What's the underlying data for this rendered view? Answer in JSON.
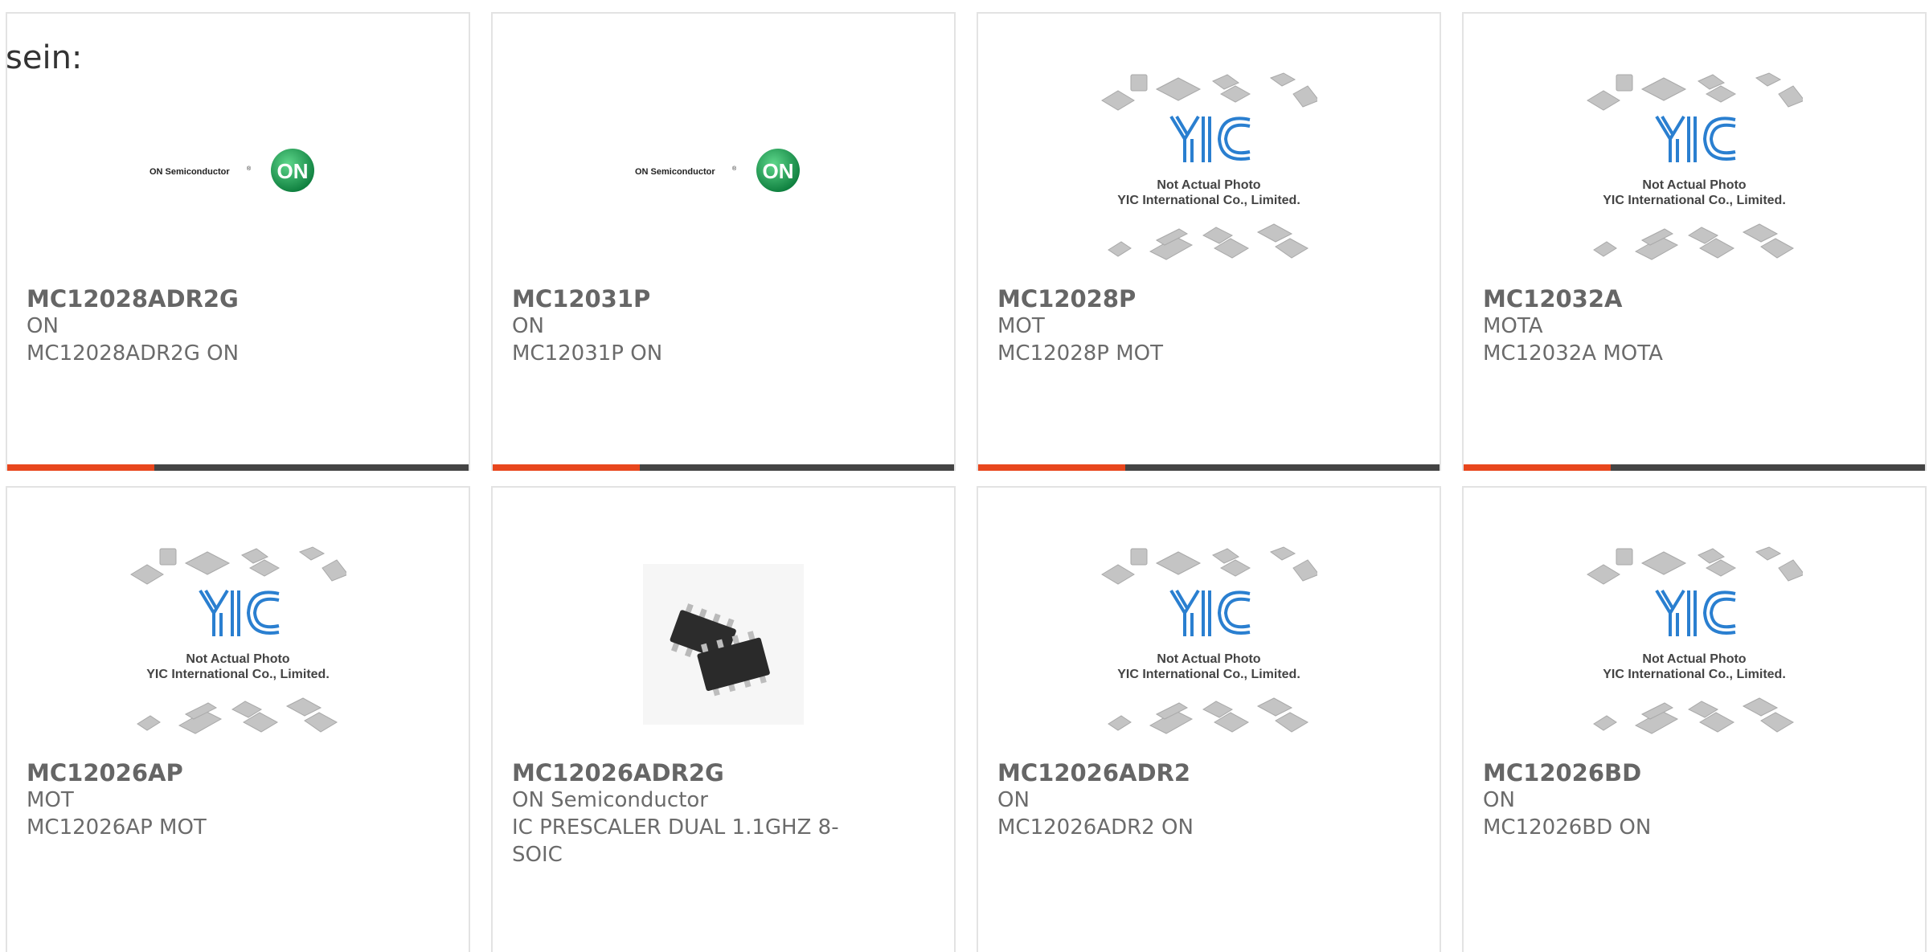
{
  "intro_text": "sein:",
  "accent_color": "#e8461d",
  "bar_color": "#444444",
  "logo_text": {
    "on_brand": "ON Semiconductor",
    "on_mark": "ON",
    "yic_mark": "YIC",
    "yic_line1": "Not Actual Photo",
    "yic_line2": "YIC International Co., Limited."
  },
  "cards": [
    {
      "part_number": "MC12028ADR2G",
      "manufacturer": "ON",
      "description": "MC12028ADR2G ON",
      "image": "on-semiconductor-logo",
      "has_bar": true
    },
    {
      "part_number": "MC12031P",
      "manufacturer": "ON",
      "description": "MC12031P ON",
      "image": "on-semiconductor-logo",
      "has_bar": true
    },
    {
      "part_number": "MC12028P",
      "manufacturer": "MOT",
      "description": "MC12028P MOT",
      "image": "yic-not-actual-photo",
      "has_bar": true
    },
    {
      "part_number": "MC12032A",
      "manufacturer": "MOTA",
      "description": "MC12032A MOTA",
      "image": "yic-not-actual-photo",
      "has_bar": true
    },
    {
      "part_number": "MC12026AP",
      "manufacturer": "MOT",
      "description": "MC12026AP MOT",
      "image": "yic-not-actual-photo",
      "has_bar": false
    },
    {
      "part_number": "MC12026ADR2G",
      "manufacturer": "ON Semiconductor",
      "description": "IC PRESCALER DUAL 1.1GHZ 8-SOIC",
      "image": "soic-8-chip-photo",
      "has_bar": false
    },
    {
      "part_number": "MC12026ADR2",
      "manufacturer": "ON",
      "description": "MC12026ADR2 ON",
      "image": "yic-not-actual-photo",
      "has_bar": false
    },
    {
      "part_number": "MC12026BD",
      "manufacturer": "ON",
      "description": "MC12026BD ON",
      "image": "yic-not-actual-photo",
      "has_bar": false
    }
  ]
}
